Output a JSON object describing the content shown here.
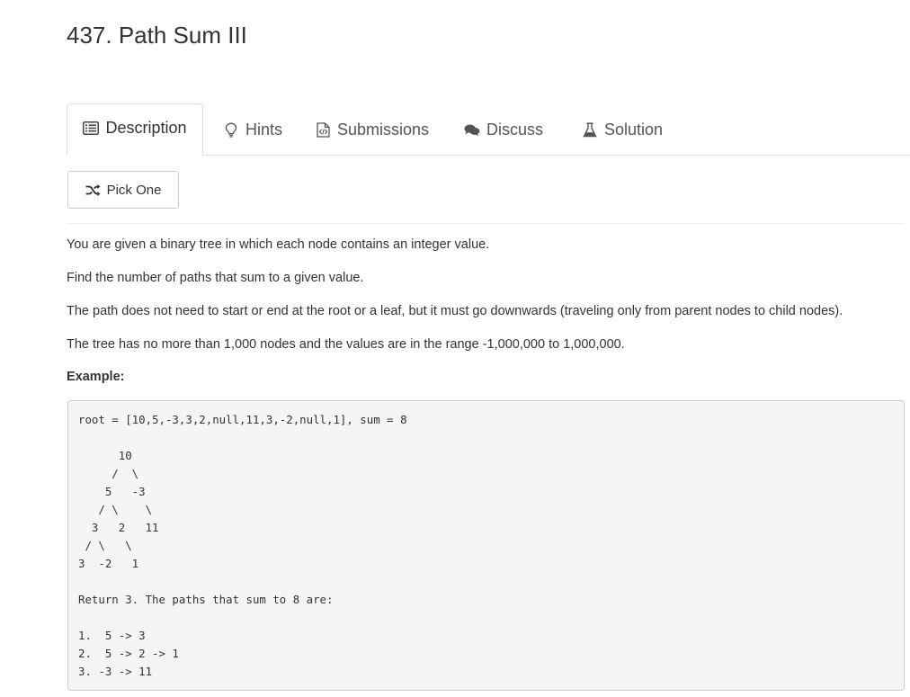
{
  "problem": {
    "title": "437. Path Sum III"
  },
  "tabs": [
    {
      "label": "Description",
      "icon": "list-icon",
      "active": true
    },
    {
      "label": "Hints",
      "icon": "lightbulb-icon",
      "active": false
    },
    {
      "label": "Submissions",
      "icon": "file-code-icon",
      "active": false
    },
    {
      "label": "Discuss",
      "icon": "comments-icon",
      "active": false
    },
    {
      "label": "Solution",
      "icon": "flask-icon",
      "active": false
    }
  ],
  "pick_one": {
    "label": "Pick One",
    "icon": "shuffle-icon"
  },
  "description": {
    "paragraphs": [
      "You are given a binary tree in which each node contains an integer value.",
      "Find the number of paths that sum to a given value.",
      "The path does not need to start or end at the root or a leaf, but it must go downwards (traveling only from parent nodes to child nodes).",
      "The tree has no more than 1,000 nodes and the values are in the range -1,000,000 to 1,000,000."
    ],
    "example_label": "Example:",
    "code_lines": [
      "root = [10,5,-3,3,2,null,11,3,-2,null,1], sum = 8",
      "",
      "      10",
      "     /  \\",
      "    5   -3",
      "   / \\    \\",
      "  3   2   11",
      " / \\   \\",
      "3  -2   1",
      "",
      "Return 3. The paths that sum to 8 are:",
      "",
      "1.  5 -> 3",
      "2.  5 -> 2 -> 1",
      "3. -3 -> 11"
    ]
  },
  "colors": {
    "text": "#333333",
    "muted_text": "#555555",
    "border": "#dddddd",
    "code_background": "#f5f5f5"
  }
}
